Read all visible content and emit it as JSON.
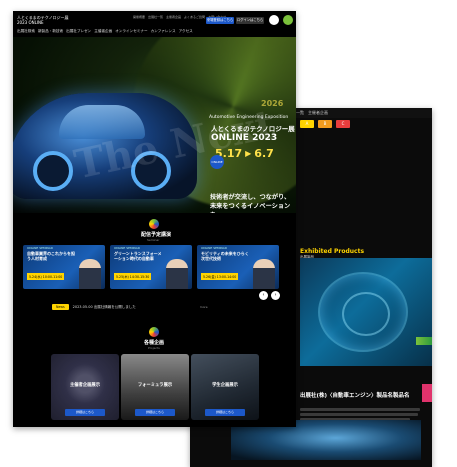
{
  "front": {
    "header": {
      "site_name": "人とくるまのテクノロジー展",
      "site_sub": "2023 ONLINE",
      "menu": [
        "出展社検索",
        "新製品・新技術",
        "出展社プレゼン",
        "主催者企画",
        "オンラインセミナー",
        "カンファレンス",
        "アクセス"
      ],
      "top_nav": [
        "開催概要",
        "出展社一覧",
        "主催者企画",
        "よくあるご質問",
        "お問い合わせ"
      ],
      "btn_register": "来場登録はこちら",
      "btn_login": "ログインはこちら"
    },
    "hero": {
      "sub_en": "Automotive Engineering Exposition",
      "title_jp": "人とくるまのテクノロジー展",
      "title_online": "ONLINE 2023",
      "date_start": "5.17",
      "date_end": "6.7",
      "badge": "ONLINE",
      "year_ghost": "2026",
      "ghost_text": "The Next",
      "tagline_line1": "技術者が交流し、つながり、",
      "tagline_line2": "未来をつくるイノベーションを"
    },
    "seminars": {
      "title": "配信予定講演",
      "subtitle": "Seminar",
      "cards": [
        {
          "title": "自動車業界のこれからを担う人材育成",
          "date": "5.24(水) 10:00-11:00",
          "chip": "ONLINE SEMINAR"
        },
        {
          "title": "グリーントランスフォーメーション時代の自動車",
          "date": "5.25(木) 14:30-15:30",
          "chip": "ONLINE SEMINAR"
        },
        {
          "title": "モビリティの未来をひらく次世代技術",
          "date": "5.26(金) 13:00-14:00",
          "chip": "ONLINE SEMINAR"
        }
      ],
      "prev_label": "‹",
      "next_label": "›"
    },
    "news": {
      "label": "News",
      "text": "2023.05.00 出展社情報を公開しました",
      "more": "more"
    },
    "projects": {
      "title": "各種企画",
      "subtitle": "Projects",
      "items": [
        {
          "label": "主催者企画展示",
          "button": "詳細はこちら"
        },
        {
          "label": "フォーミュラ展示",
          "button": "詳細はこちら"
        },
        {
          "label": "学生企画展示",
          "button": "詳細はこちら"
        }
      ]
    }
  },
  "back": {
    "topbar": [
      "開催概要",
      "出展社一覧",
      "主催者企画"
    ],
    "nav_label": "ワークショップ・ワークショップ",
    "tabs": [
      "A",
      "B",
      "C"
    ],
    "section_en": "Exhibited Products",
    "section_sub": "出展製品",
    "product_title": "出展社(株)〈自動車エンジン〉製品名製品名",
    "link": "製品名製品名製品名製品名製品名 →"
  },
  "colors": {
    "accent_blue": "#1c58c9",
    "accent_yellow": "#ffd400",
    "accent_green": "#7bc13b",
    "accent_pink": "#e0336c"
  }
}
